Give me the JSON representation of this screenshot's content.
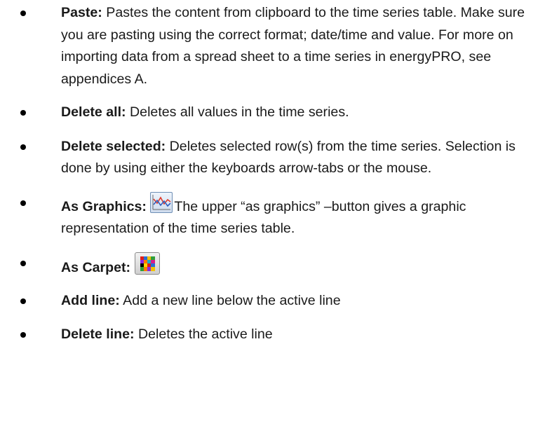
{
  "items": [
    {
      "term": "Paste:",
      "text": " Pastes the content from clipboard to the time series table. Make sure you are pasting using the correct format; date/time and value. For more on importing data from a spread sheet to a time series in energyPRO, see appendices A."
    },
    {
      "term": "Delete all:",
      "text": " Deletes all values in the time series."
    },
    {
      "term": "Delete selected:",
      "text": " Deletes selected row(s) from the time series. Selection is done by using either the keyboards arrow-tabs or the mouse."
    },
    {
      "term": "As Graphics:",
      "icon": "line-graph-icon",
      "text": "The upper “as graphics” –button gives a graphic representation of the time series table."
    },
    {
      "term": "As Carpet:",
      "icon": "carpet-plot-icon",
      "text": ""
    },
    {
      "term": "Add line:",
      "text": " Add a new line below the active line"
    },
    {
      "term": "Delete line:",
      "text": " Deletes the active line"
    }
  ],
  "colors": {
    "text": "#1a1a1a",
    "graph_line_red": "#e03a2a",
    "graph_line_blue": "#2f5fbf",
    "carpet_cells": [
      "#e0201a",
      "#2a6ed6",
      "#f2c200",
      "#2e9e3a",
      "#8a2be2",
      "#ff7a00",
      "#1ab0c8",
      "#d81b8c",
      "#000000",
      "#ffd400",
      "#e0201a",
      "#2a6ed6",
      "#2e9e3a",
      "#ff7a00",
      "#8a2be2",
      "#f2c200"
    ]
  }
}
